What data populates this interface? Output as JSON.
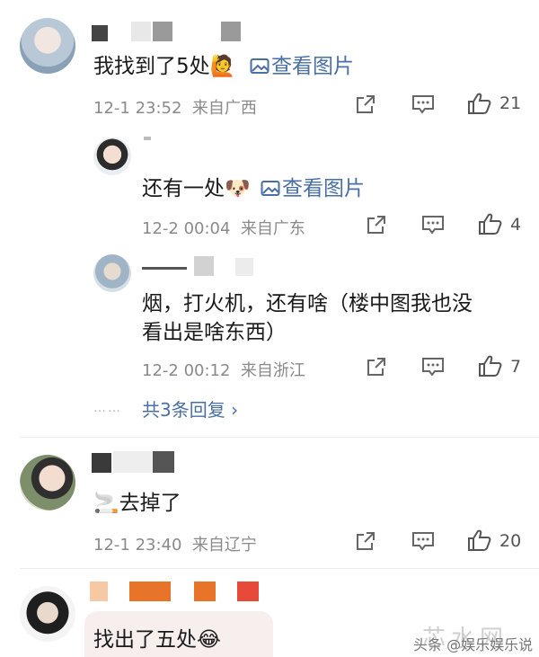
{
  "comments": [
    {
      "text": "我找到了5处",
      "emoji": "🙋",
      "image_link": "查看图片",
      "timestamp": "12-1 23:52",
      "location": "来自广西",
      "like_count": "21"
    },
    {
      "text": "还有一处",
      "emoji": "🐶",
      "image_link": "查看图片",
      "timestamp": "12-2 00:04",
      "location": "来自广东",
      "like_count": "4"
    },
    {
      "text_line1": "烟，打火机，还有啥（楼中图我也没",
      "text_line2": "看出是啥东西）",
      "timestamp": "12-2 00:12",
      "location": "来自浙江",
      "like_count": "7"
    },
    {
      "emoji": "🚬",
      "text": "去掉了",
      "timestamp": "12-1 23:40",
      "location": "来自辽宁",
      "like_count": "20"
    },
    {
      "text": "找出了五处",
      "emoji": "😂"
    }
  ],
  "reply_summary": {
    "dots": "……",
    "label": "共3条回复",
    "chevron": "›"
  },
  "watermark": {
    "big": "芯水网",
    "small": "头条 @娱乐娱乐说"
  },
  "colors": {
    "link": "#4a6fa5",
    "meta": "#8a8a8a",
    "name_orange": "#e8742a",
    "name_red": "#e84a3a"
  }
}
